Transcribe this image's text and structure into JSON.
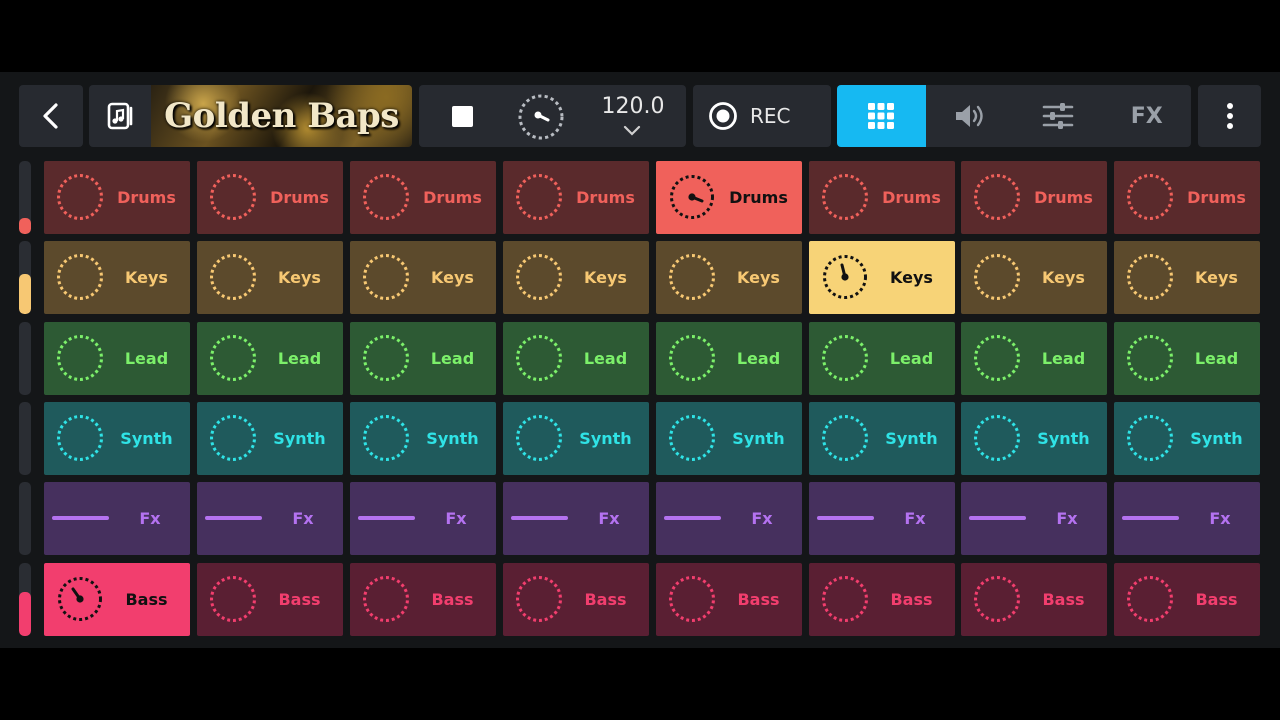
{
  "toolbar": {
    "song_title": "Golden Baps",
    "tempo": "120.0",
    "rec_label": "REC",
    "views": [
      {
        "name": "pads",
        "label": ""
      },
      {
        "name": "mixer",
        "label": ""
      },
      {
        "name": "eq",
        "label": ""
      },
      {
        "name": "fx",
        "label": "FX"
      }
    ]
  },
  "colors": {
    "accent": "#16b9f2",
    "drums": "#f0615b",
    "keys": "#f7c873",
    "lead": "#7cf06a",
    "synth": "#2fe3e6",
    "fx": "#b472f0",
    "bass": "#f23e6e"
  },
  "rows": [
    {
      "label": "Drums",
      "key": "drums",
      "style": "ring",
      "active_col": 4,
      "fg": "#f0615b",
      "bg": "#5a2a2c",
      "active_bg": "#f0615b",
      "level": 0.22
    },
    {
      "label": "Keys",
      "key": "keys",
      "style": "ring",
      "active_col": 5,
      "fg": "#f7c873",
      "bg": "#5c4a2c",
      "active_bg": "#f7d377",
      "level": 0.55
    },
    {
      "label": "Lead",
      "key": "lead",
      "style": "ring",
      "active_col": -1,
      "fg": "#7cf06a",
      "bg": "#2d5a34",
      "active_bg": "#7cf06a",
      "level": 0
    },
    {
      "label": "Synth",
      "key": "synth",
      "style": "ring",
      "active_col": -1,
      "fg": "#2fe3e6",
      "bg": "#1f5a5c",
      "active_bg": "#2fe3e6",
      "level": 0
    },
    {
      "label": "Fx",
      "key": "fx",
      "style": "line",
      "active_col": -1,
      "fg": "#b472f0",
      "bg": "#46305e",
      "active_bg": "#b472f0",
      "level": 0
    },
    {
      "label": "Bass",
      "key": "bass",
      "style": "ring",
      "active_col": 0,
      "fg": "#f23e6e",
      "bg": "#5a1f33",
      "active_bg": "#f23e6e",
      "level": 0.6
    }
  ],
  "columns": 8
}
